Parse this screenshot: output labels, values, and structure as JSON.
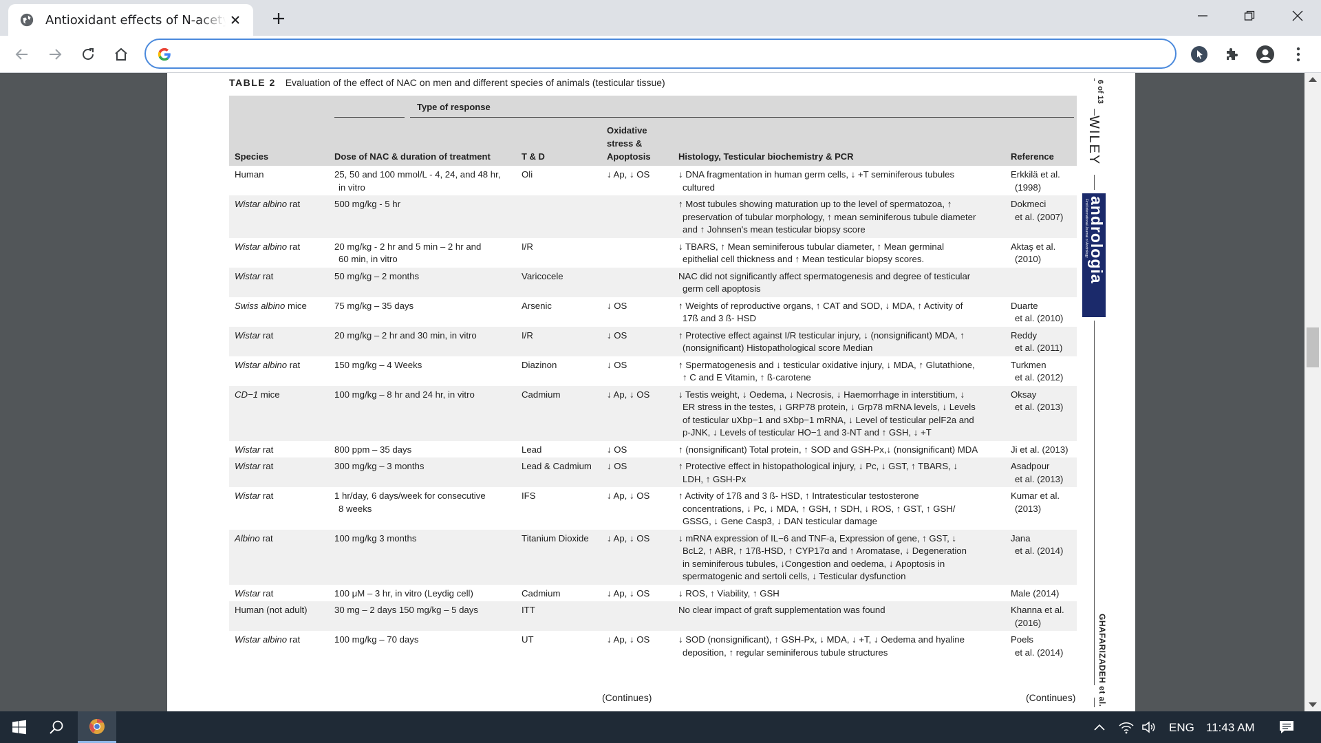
{
  "browser": {
    "tab_title": "Antioxidant effects of N-acetylcysteine",
    "address_value": "",
    "colors": {
      "accent": "#4a89dc",
      "chrome": "#dee1e6",
      "logo_blue": "#1b2a6b"
    }
  },
  "table": {
    "label": "TABLE 2",
    "caption": "Evaluation of the effect of NAC on men and different species of animals (testicular tissue)",
    "group_header": "Type of response",
    "headers": {
      "species": "Species",
      "dose": "Dose of NAC & duration of treatment",
      "td": "T & D",
      "ox_1": "Oxidative",
      "ox_2": "stress &",
      "ox_3": "Apoptosis",
      "histology": "Histology, Testicular biochemistry & PCR",
      "reference": "Reference"
    },
    "rows": [
      {
        "species": "Human",
        "species_italic": "",
        "dose": [
          "25, 50 and 100 mmol/L - 4, 24, and 48 hr,",
          "in vitro"
        ],
        "td": "Oli",
        "ox": "↓ Ap, ↓ OS",
        "hist": [
          "↓ DNA fragmentation in human germ cells, ↓ +T seminiferous tubules",
          "cultured"
        ],
        "ref": [
          "Erkkilä et al.",
          "(1998)"
        ],
        "shade": false
      },
      {
        "species": " rat",
        "species_italic": "Wistar albino",
        "dose": [
          "500 mg/kg - 5 hr"
        ],
        "td": "",
        "ox": "",
        "hist": [
          "↑ Most tubules showing maturation up to the level of spermatozoa, ↑",
          "preservation of tubular morphology, ↑ mean seminiferous tubule diameter",
          "and ↑ Johnsen's mean testicular biopsy score"
        ],
        "ref": [
          "Dokmeci",
          "et al. (2007)"
        ],
        "shade": true
      },
      {
        "species": " rat",
        "species_italic": "Wistar albino",
        "dose": [
          "20 mg/kg - 2 hr and 5 min – 2 hr and",
          "60 min, in vitro"
        ],
        "td": "I/R",
        "ox": "",
        "hist": [
          "↓ TBARS, ↑ Mean seminiferous tubular diameter, ↑ Mean germinal",
          "epithelial cell thickness and ↑ Mean testicular biopsy scores."
        ],
        "ref": [
          "Aktaş et al.",
          "(2010)"
        ],
        "shade": false
      },
      {
        "species": " rat",
        "species_italic": "Wistar",
        "dose": [
          "50 mg/kg – 2 months"
        ],
        "td": "Varicocele",
        "ox": "",
        "hist": [
          "NAC did not significantly affect spermatogenesis and degree of testicular",
          "germ cell apoptosis"
        ],
        "ref": [
          ""
        ],
        "shade": true
      },
      {
        "species": " mice",
        "species_italic": "Swiss albino",
        "dose": [
          "75 mg/kg – 35 days"
        ],
        "td": "Arsenic",
        "ox": "↓ OS",
        "hist": [
          "↑ Weights of reproductive organs, ↑ CAT and SOD, ↓ MDA, ↑ Activity of",
          "17ß and 3 ß- HSD"
        ],
        "ref": [
          "Duarte",
          "et al. (2010)"
        ],
        "shade": false
      },
      {
        "species": " rat",
        "species_italic": "Wistar",
        "dose": [
          "20 mg/kg – 2 hr and 30 min, in vitro"
        ],
        "td": "I/R",
        "ox": "↓ OS",
        "hist": [
          "↑ Protective effect against I/R testicular injury, ↓ (nonsignificant) MDA, ↑",
          "(nonsignificant) Histopathological score Median"
        ],
        "ref": [
          "Reddy",
          "et al. (2011)"
        ],
        "shade": true
      },
      {
        "species": " rat",
        "species_italic": "Wistar albino",
        "dose": [
          "150 mg/kg – 4 Weeks"
        ],
        "td": "Diazinon",
        "ox": "↓ OS",
        "hist": [
          "↑ Spermatogenesis and ↓ testicular oxidative injury, ↓ MDA, ↑ Glutathione,",
          "↑ C and E Vitamin, ↑ ß-carotene"
        ],
        "ref": [
          "Turkmen",
          "et al. (2012)"
        ],
        "shade": false
      },
      {
        "species": " mice",
        "species_italic": "CD−1",
        "dose": [
          "100 mg/kg – 8 hr and 24 hr, in vitro"
        ],
        "td": "Cadmium",
        "ox": "↓ Ap, ↓ OS",
        "hist": [
          "↓ Testis weight, ↓ Oedema, ↓ Necrosis, ↓ Haemorrhage in interstitium, ↓",
          "ER stress in the testes, ↓ GRP78 protein, ↓ Grp78 mRNA levels, ↓ Levels",
          "of testicular uXbp−1 and sXbp−1 mRNA, ↓ Level of testicular pelF2a and",
          "p-JNK, ↓ Levels of testicular HO−1 and 3-NT and ↑ GSH, ↓ +T"
        ],
        "ref": [
          "Oksay",
          "et al. (2013)"
        ],
        "shade": true
      },
      {
        "species": " rat",
        "species_italic": "Wistar",
        "dose": [
          "800 ppm – 35 days"
        ],
        "td": "Lead",
        "ox": "↓ OS",
        "hist": [
          "↑ (nonsignificant) Total protein, ↑ SOD and GSH-Px,↓ (nonsignificant) MDA"
        ],
        "ref": [
          "Ji et al. (2013)"
        ],
        "shade": false
      },
      {
        "species": " rat",
        "species_italic": "Wistar",
        "dose": [
          "300 mg/kg – 3 months"
        ],
        "td": "Lead & Cadmium",
        "ox": "↓ OS",
        "hist": [
          "↑ Protective effect in histopathological injury, ↓ Pc, ↓ GST, ↑ TBARS, ↓",
          "LDH, ↑ GSH-Px"
        ],
        "ref": [
          "Asadpour",
          "et al. (2013)"
        ],
        "shade": true
      },
      {
        "species": " rat",
        "species_italic": "Wistar",
        "dose": [
          "1 hr/day, 6 days/week for consecutive",
          "8 weeks"
        ],
        "td": "IFS",
        "ox": "↓ Ap, ↓ OS",
        "hist": [
          "↑ Activity of 17ß and 3 ß- HSD, ↑ Intratesticular testosterone",
          "concentrations, ↓ Pc, ↓ MDA, ↑ GSH, ↑ SDH, ↓ ROS, ↑ GST, ↑ GSH/",
          "GSSG, ↓ Gene Casp3, ↓ DAN testicular damage"
        ],
        "ref": [
          "Kumar et al.",
          "(2013)"
        ],
        "shade": false
      },
      {
        "species": " rat",
        "species_italic": "Albino",
        "dose": [
          "100 mg/kg 3 months"
        ],
        "td": "Titanium Dioxide",
        "ox": "↓ Ap, ↓ OS",
        "hist": [
          "↓ mRNA expression of IL−6 and TNF-a, Expression of gene, ↑ GST, ↓",
          "BcL2, ↑ ABR, ↑ 17ß-HSD, ↑ CYP17α and ↑ Aromatase, ↓ Degeneration",
          "in seminiferous tubules, ↓Congestion and oedema, ↓ Apoptosis in",
          "spermatogenic and sertoli cells, ↓ Testicular dysfunction"
        ],
        "ref": [
          "Jana",
          "et al. (2014)"
        ],
        "shade": true
      },
      {
        "species": " rat",
        "species_italic": "Wistar",
        "dose": [
          "100 μM – 3 hr, in vitro (Leydig cell)"
        ],
        "td": "Cadmium",
        "ox": "↓ Ap, ↓ OS",
        "hist": [
          "↓ ROS, ↑ Viability, ↑ GSH"
        ],
        "ref": [
          "Male (2014)"
        ],
        "shade": false
      },
      {
        "species": "Human (not adult)",
        "species_italic": "",
        "dose": [
          "30 mg – 2 days 150 mg/kg – 5 days"
        ],
        "td": "ITT",
        "ox": "",
        "hist": [
          "No clear impact of graft supplementation was found"
        ],
        "ref": [
          "Khanna et al.",
          "(2016)"
        ],
        "shade": true
      },
      {
        "species": " rat",
        "species_italic": "Wistar albino",
        "dose": [
          "100 mg/kg – 70 days"
        ],
        "td": "UT",
        "ox": "↓ Ap, ↓ OS",
        "hist": [
          "↓ SOD (nonsignificant), ↑ GSH-Px, ↓ MDA, ↓ +T, ↓ Oedema and hyaline",
          "deposition, ↑ regular seminiferous tubule structures"
        ],
        "ref": [
          "Poels",
          "et al. (2014)"
        ],
        "shade": false
      }
    ],
    "continues_1": "(Continues)",
    "continues_2": "(Continues)"
  },
  "journal": {
    "page": "6 of 13",
    "publisher": "WILEY",
    "name": "andrologia",
    "tagline": "First International Journal of Andrology",
    "author": "GHAFARIZADEH et al."
  },
  "taskbar": {
    "language": "ENG",
    "time": "11:43 AM"
  }
}
